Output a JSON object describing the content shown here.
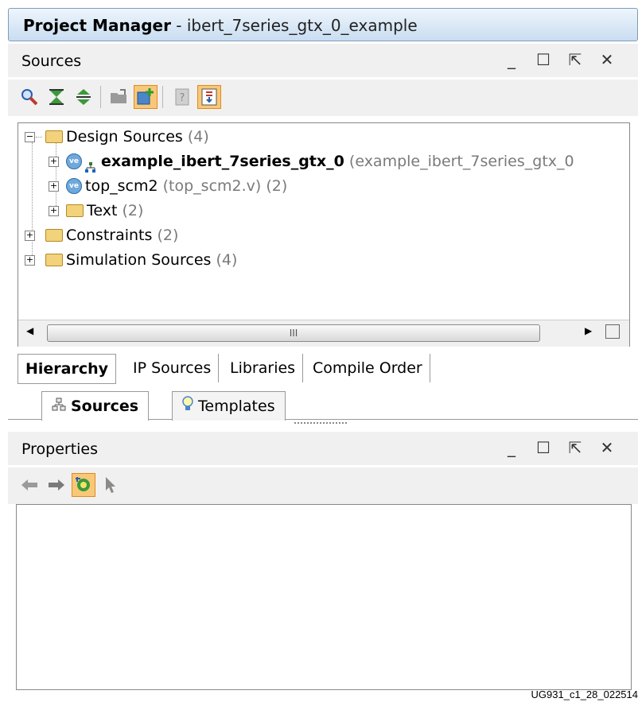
{
  "window": {
    "title": "Project Manager",
    "subtitle": "- ibert_7series_gtx_0_example"
  },
  "sources_panel": {
    "label": "Sources",
    "window_buttons": [
      "minimize-icon",
      "maximize-icon",
      "float-icon",
      "close-icon"
    ],
    "toolbar_icons": [
      "search-icon",
      "collapse-all-icon",
      "expand-all-icon",
      "open-file-icon",
      "add-sources-icon",
      "properties-icon",
      "show-hierarchy-icon"
    ],
    "tree": {
      "design_sources": {
        "label": "Design Sources",
        "count": "(4)"
      },
      "example": {
        "label": "example_ibert_7series_gtx_0",
        "detail": "(example_ibert_7series_gtx_0"
      },
      "top": {
        "label": "top_scm2",
        "detail": "(top_scm2.v) (2)"
      },
      "text": {
        "label": "Text",
        "count": "(2)"
      },
      "constraints": {
        "label": "Constraints",
        "count": "(2)"
      },
      "simulation": {
        "label": "Simulation Sources",
        "count": "(4)"
      }
    },
    "scroll_thumb": "III",
    "view_tabs": [
      "Hierarchy",
      "IP Sources",
      "Libraries",
      "Compile Order"
    ]
  },
  "main_tabs": [
    "Sources",
    "Templates"
  ],
  "properties_panel": {
    "label": "Properties",
    "toolbar_icons": [
      "back-arrow-icon",
      "forward-arrow-icon",
      "auto-update-icon",
      "select-pointer-icon"
    ]
  },
  "caption": "UG931_c1_28_022514",
  "colors": {
    "title_bar": "#c9ddf1",
    "active_button": "#f8c878",
    "folder": "#f2d27a"
  }
}
